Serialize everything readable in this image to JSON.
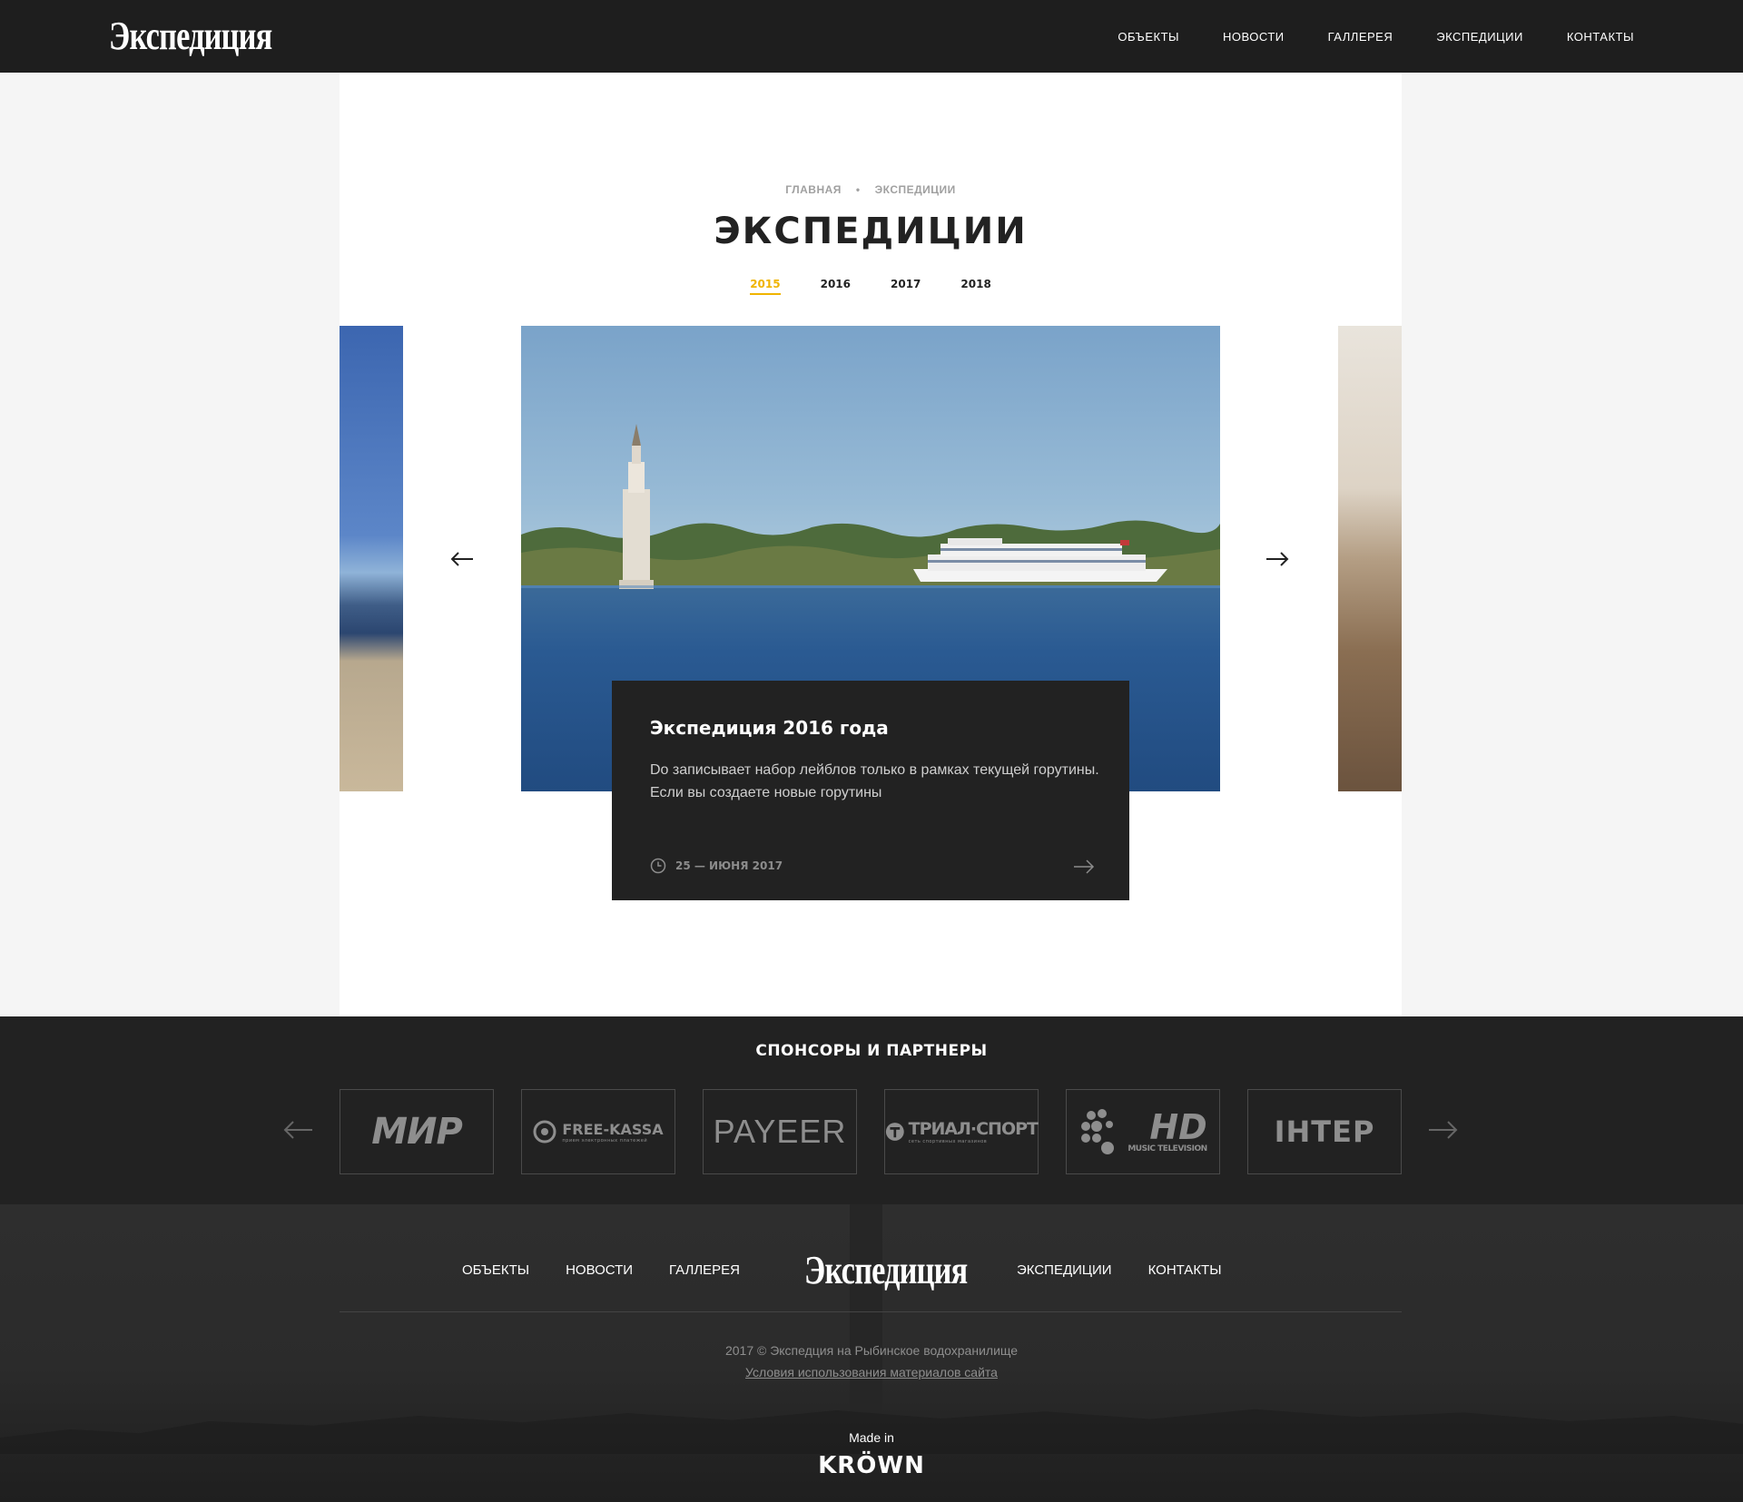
{
  "header": {
    "logo": "Экспедиция",
    "nav": [
      "ОБЪЕКТЫ",
      "НОВОСТИ",
      "ГАЛЛЕРЕЯ",
      "ЭКСПЕДИЦИИ",
      "КОНТАКТЫ"
    ]
  },
  "breadcrumb": {
    "home": "ГЛАВНАЯ",
    "separator": "•",
    "current": "ЭКСПЕДИЦИИ"
  },
  "page_title": "ЭКСПЕДИЦИИ",
  "years": {
    "items": [
      "2015",
      "2016",
      "2017",
      "2018"
    ],
    "active": "2015",
    "active_color": "#f0b400"
  },
  "slider": {
    "card": {
      "title": "Экспедиция 2016 года",
      "text": "Do записывает набор лейблов только в рамках текущей горутины. Если вы создаете новые горутины",
      "date": "25 — ИЮНЯ 2017"
    },
    "icons": {
      "prev": "arrow-left-icon",
      "next": "arrow-right-icon",
      "date": "clock-icon",
      "more": "arrow-right-icon"
    }
  },
  "sponsors": {
    "title": "СПОНСОРЫ И ПАРТНЕРЫ",
    "logos": [
      "МИР",
      "FREE-KASSA",
      "PAYEER",
      "ТРИАЛ·СПОРТ",
      "HD",
      "ІНТЕР"
    ],
    "logo_sublabels": {
      "free_kassa": "прием электронных платежей",
      "trial_sport": "сеть спортивных магазинов",
      "hd": "MUSIC TELEVISION"
    }
  },
  "footer": {
    "nav_left": [
      "ОБЪЕКТЫ",
      "НОВОСТИ",
      "ГАЛЛЕРЕЯ"
    ],
    "logo": "Экспедиция",
    "nav_right": [
      "ЭКСПЕДИЦИИ",
      "КОНТАКТЫ"
    ],
    "copyright": "2017 © Экспедция на Рыбинское водохранилище",
    "terms": "Условия использования материалов сайта",
    "made_in": "Made in",
    "studio": "KRÖWN"
  },
  "colors": {
    "header_bg": "#1e1e1e",
    "accent": "#f0b400",
    "card_bg": "#222222",
    "footer_bg": "#2b2b2b"
  }
}
